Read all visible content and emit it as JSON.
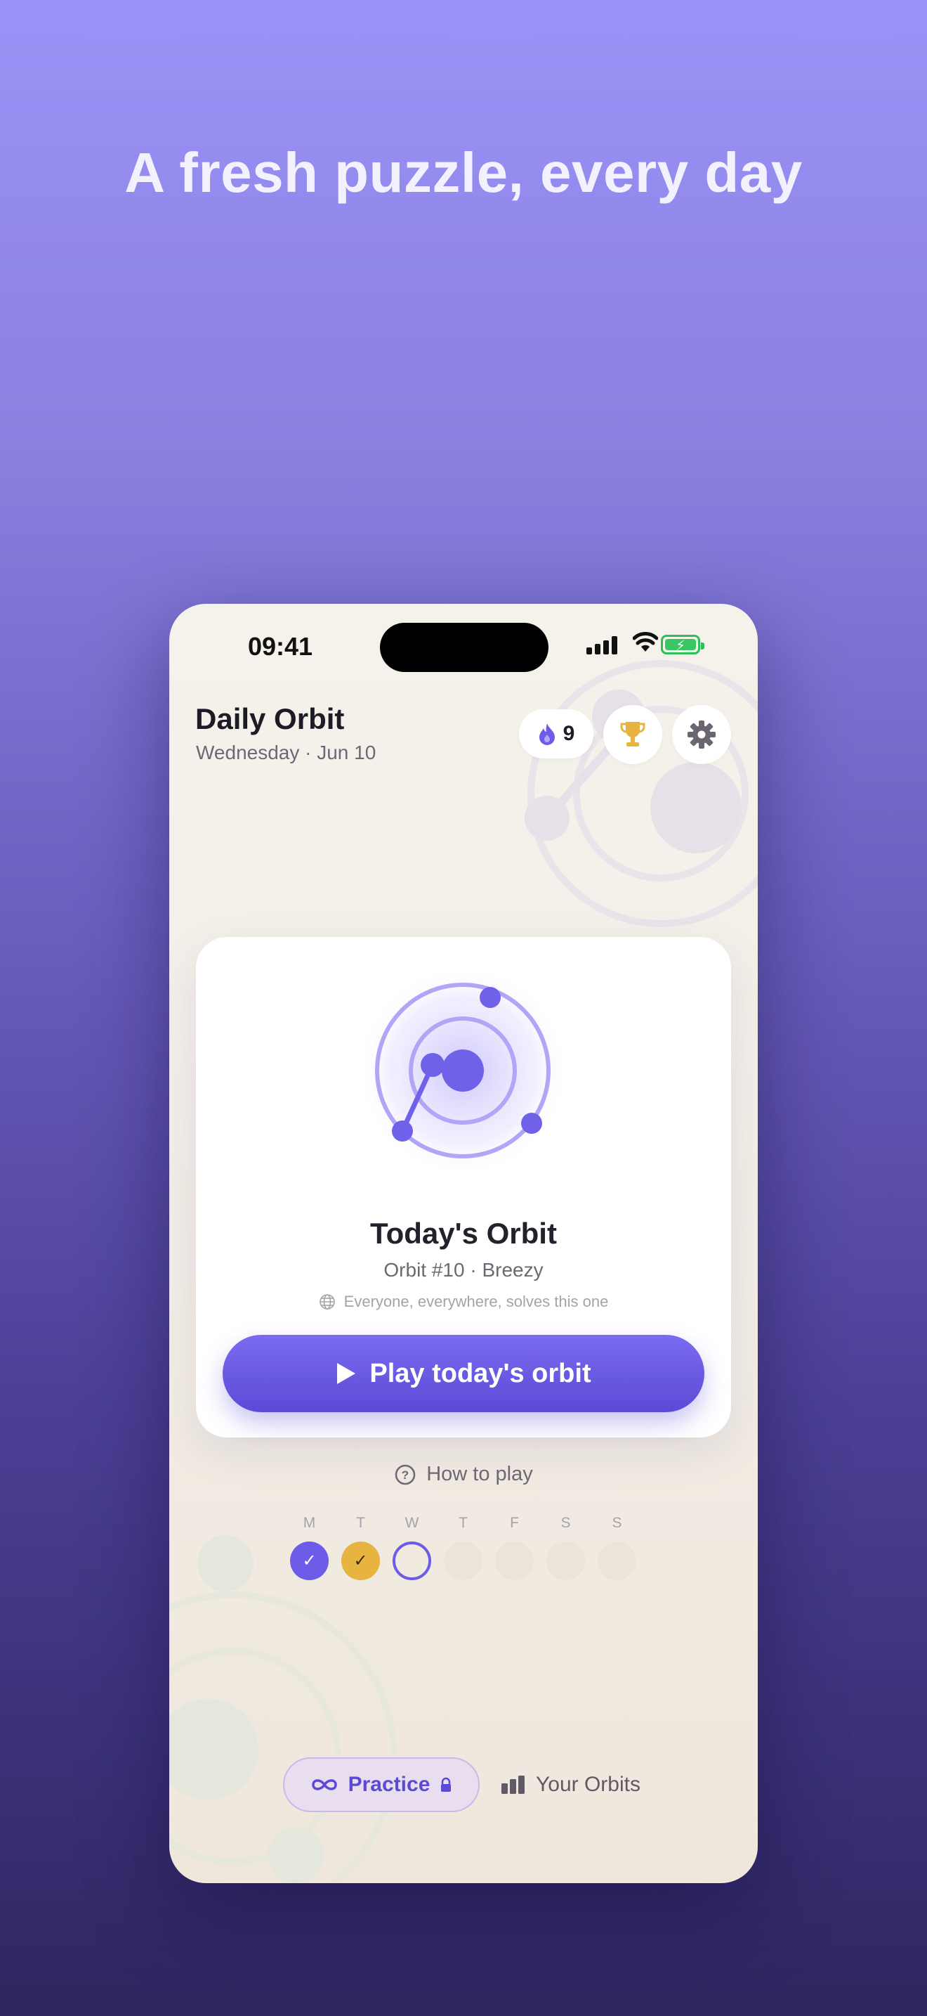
{
  "headline": "A fresh puzzle, every day",
  "status_bar": {
    "time": "09:41"
  },
  "header": {
    "title": "Daily Orbit",
    "date": "Wednesday · Jun 10",
    "streak_count": "9",
    "streak_icon": "flame-icon",
    "trophy_icon": "trophy-icon",
    "settings_icon": "gear-icon"
  },
  "card": {
    "title": "Today's Orbit",
    "subtitle": "Orbit #10 · Breezy",
    "note": "Everyone, everywhere, solves this one",
    "play_label": "Play today's orbit"
  },
  "how_to_play": "How to play",
  "week": [
    {
      "letter": "M",
      "state": "done",
      "mark": "✓"
    },
    {
      "letter": "T",
      "state": "gold",
      "mark": "✓"
    },
    {
      "letter": "W",
      "state": "today",
      "mark": ""
    },
    {
      "letter": "T",
      "state": "empty",
      "mark": ""
    },
    {
      "letter": "F",
      "state": "empty",
      "mark": ""
    },
    {
      "letter": "S",
      "state": "empty",
      "mark": ""
    },
    {
      "letter": "S",
      "state": "empty",
      "mark": ""
    }
  ],
  "bottom_nav": {
    "practice_label": "Practice",
    "orbits_label": "Your Orbits"
  },
  "colors": {
    "accent": "#6c5ce7",
    "gold": "#e6b43f",
    "card_bg": "#ffffff"
  }
}
